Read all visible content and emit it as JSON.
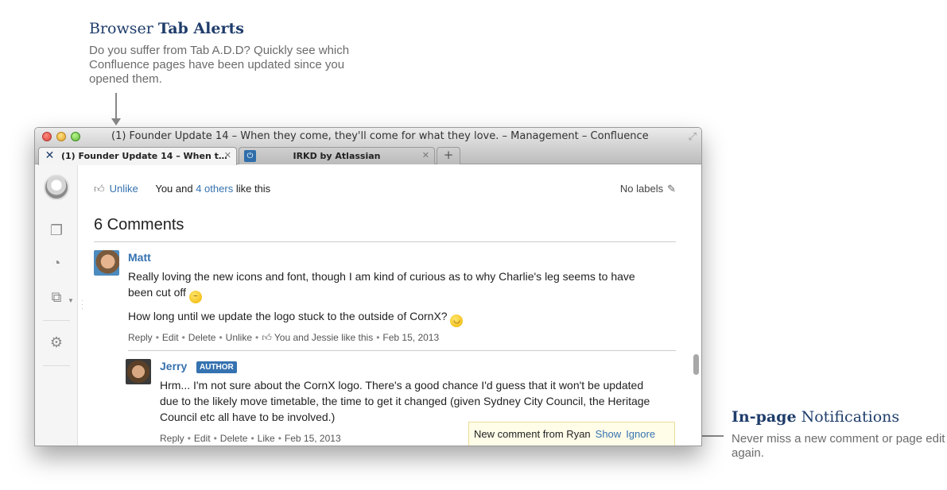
{
  "callouts": {
    "tab_alerts": {
      "title_light": "Browser",
      "title_bold": "Tab Alerts",
      "text": "Do you suffer from Tab A.D.D? Quickly see which Confluence pages have been updated since you opened them."
    },
    "in_page": {
      "title_bold": "In-page",
      "title_light": "Notifications",
      "text": "Never miss a new comment or page edit again."
    }
  },
  "window": {
    "title": "(1) Founder Update 14 – When they come, they'll come for what they love. – Management – Confluence"
  },
  "tabs": [
    {
      "label": "(1) Founder Update 14 – When t…",
      "icon": "confluence-icon",
      "active": true
    },
    {
      "label": "IRKD by Atlassian",
      "icon": "irkd-icon",
      "active": false
    }
  ],
  "new_tab_label": "+",
  "like_bar": {
    "unlike_label": "Unlike",
    "like_text_prefix": "You and",
    "like_link": "4 others",
    "like_text_suffix": "like this",
    "labels_text": "No labels"
  },
  "comments_heading": "6 Comments",
  "comments": [
    {
      "author": "Matt",
      "paragraph1_line1": "Really loving the new icons and font, though I am kind of curious as to why Charlie's leg seems to have",
      "paragraph1_line2": "been cut off",
      "paragraph2": "How long until we update the logo stuck to the outside of CornX?",
      "actions": {
        "reply": "Reply",
        "edit": "Edit",
        "delete": "Delete",
        "unlike": "Unlike",
        "likes": "You and Jessie like this",
        "date": "Feb 15, 2013"
      }
    },
    {
      "author": "Jerry",
      "badge": "AUTHOR",
      "line1": "Hrm... I'm not sure about the CornX logo. There's a good chance I'd guess that it won't be updated",
      "line2": "due to the likely move timetable, the time to get it changed (given Sydney City Council, the Heritage",
      "line3": "Council etc all have to be involved.)",
      "actions": {
        "reply": "Reply",
        "edit": "Edit",
        "delete": "Delete",
        "like": "Like",
        "date": "Feb 15, 2013"
      }
    }
  ],
  "notification": {
    "text": "New comment from Ryan",
    "show": "Show",
    "ignore": "Ignore"
  }
}
